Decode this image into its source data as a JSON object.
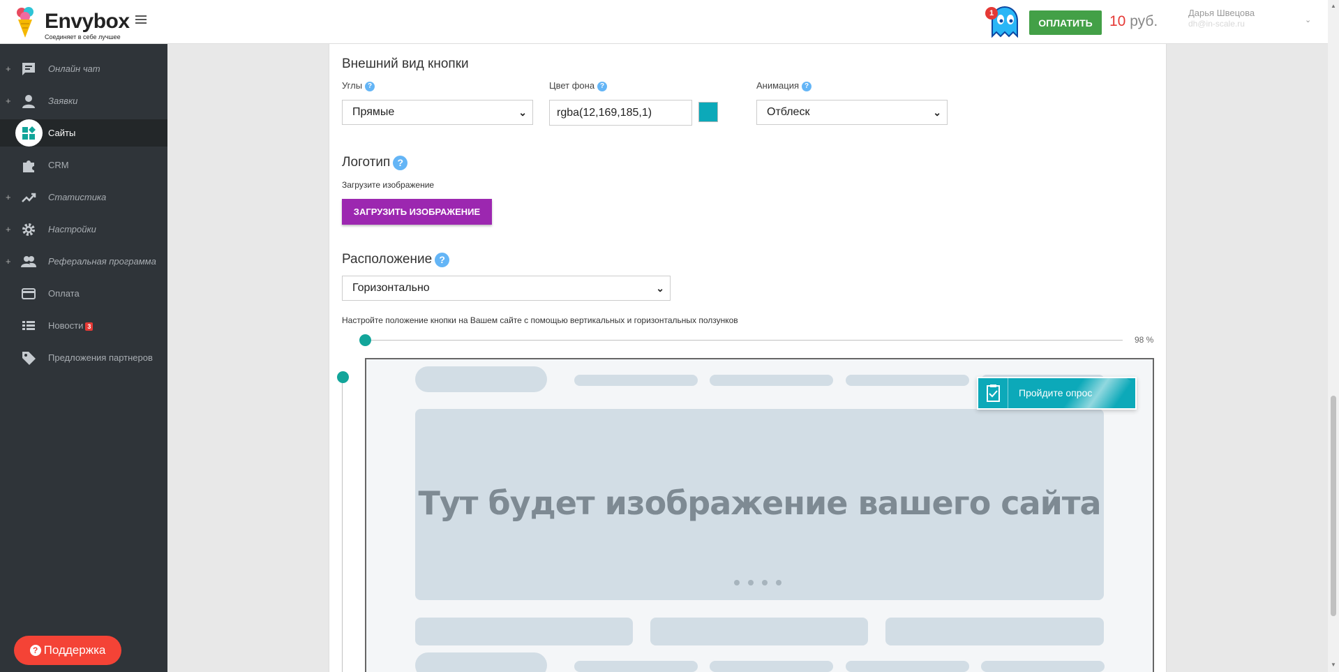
{
  "header": {
    "logo_name": "Envybox",
    "logo_tagline": "Соединяет в себе лучшее",
    "notifications_count": "1",
    "pay_label": "ОПЛАТИТЬ",
    "balance_amount": "10",
    "balance_currency": "руб.",
    "user_name": "Дарья Швецова",
    "user_email": "dh@in-scale.ru"
  },
  "sidebar": {
    "items": [
      {
        "label": "Онлайн чат",
        "icon": "chat-icon"
      },
      {
        "label": "Заявки",
        "icon": "person-icon"
      },
      {
        "label": "Сайты",
        "icon": "widgets-icon",
        "active": true
      },
      {
        "label": "CRM",
        "icon": "puzzle-icon"
      },
      {
        "label": "Статистика",
        "icon": "trending-icon"
      },
      {
        "label": "Настройки",
        "icon": "gear-icon"
      },
      {
        "label": "Реферальная программа",
        "icon": "people-icon"
      },
      {
        "label": "Оплата",
        "icon": "card-icon"
      },
      {
        "label": "Новости",
        "icon": "list-icon",
        "badge": "3"
      },
      {
        "label": "Предложения партнеров",
        "icon": "tag-icon"
      }
    ],
    "support_label": "Поддержка"
  },
  "main": {
    "appearance_title": "Внешний вид кнопки",
    "corners": {
      "label": "Углы",
      "value": "Прямые"
    },
    "bg_color": {
      "label": "Цвет фона",
      "value": "rgba(12,169,185,1)",
      "swatch": "#0ca9b9"
    },
    "animation": {
      "label": "Анимация",
      "value": "Отблеск"
    },
    "logo_title": "Логотип",
    "logo_hint": "Загрузите изображение",
    "upload_label": "ЗАГРУЗИТЬ ИЗОБРАЖЕНИЕ",
    "position_title": "Расположение",
    "position": {
      "value": "Горизонтально"
    },
    "position_hint": "Настройте положение кнопки на Вашем сайте с помощью вертикальных и горизонтальных ползунков",
    "h_slider_value": 0,
    "h_slider_label": "98 %",
    "preview_text": "Тут будет изображение вашего сайта",
    "survey_button_label": "Пройдите опрос"
  },
  "colors": {
    "accent": "#12a59a",
    "pay": "#43a047",
    "upload": "#9c27b0",
    "support": "#f44336",
    "sidebar_bg": "#2f3439"
  }
}
